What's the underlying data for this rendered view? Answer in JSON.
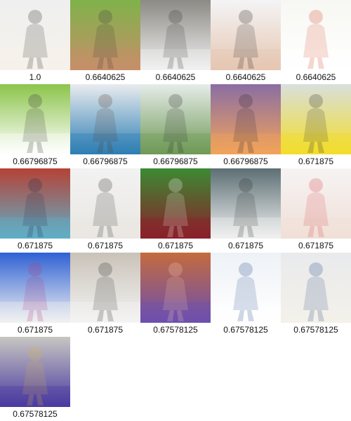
{
  "results": [
    {
      "score": "1.0",
      "thumb": "woman-white-outfit-photo",
      "colors": [
        "#efefef",
        "#f6f2ea",
        "#2b2b2b"
      ]
    },
    {
      "score": "0.6640625",
      "thumb": "man-shirtless-on-grass-photo",
      "colors": [
        "#7fb24a",
        "#c78f6a",
        "#3a3a3a"
      ]
    },
    {
      "score": "0.6640625",
      "thumb": "man-white-shirt-steps-photo",
      "colors": [
        "#8c8a84",
        "#f2f2f2",
        "#333333"
      ]
    },
    {
      "score": "0.6640625",
      "thumb": "skater-crouching-photo",
      "colors": [
        "#f4f4f6",
        "#e6c7b1",
        "#222222"
      ]
    },
    {
      "score": "0.6640625",
      "thumb": "woman-kitchen-food-photo",
      "colors": [
        "#f7f7f3",
        "#ffffff",
        "#d64b2f"
      ]
    },
    {
      "score": "0.66796875",
      "thumb": "golfer-swing-photo",
      "colors": [
        "#8cc44b",
        "#ffffff",
        "#2e2e2e"
      ]
    },
    {
      "score": "0.66796875",
      "thumb": "woman-blue-skirt-photo",
      "colors": [
        "#e9ecef",
        "#2f7fb4",
        "#5a3b2a"
      ]
    },
    {
      "score": "0.66796875",
      "thumb": "people-jumping-field-photo",
      "colors": [
        "#e6ece9",
        "#6f9a57",
        "#2b2b2b"
      ]
    },
    {
      "score": "0.66796875",
      "thumb": "fisherman-silhouette-sunset-photo",
      "colors": [
        "#8a6ea3",
        "#f2a35a",
        "#2b2230"
      ]
    },
    {
      "score": "0.671875",
      "thumb": "man-yellow-jacket-chair-photo",
      "colors": [
        "#d9dfdc",
        "#f3dd2a",
        "#2b2b2b"
      ]
    },
    {
      "score": "0.671875",
      "thumb": "people-traditional-dress-photo",
      "colors": [
        "#b54236",
        "#5fb0c8",
        "#1f2b4a"
      ]
    },
    {
      "score": "0.671875",
      "thumb": "woman-white-sweater-door-photo",
      "colors": [
        "#f2f2f2",
        "#eae7e2",
        "#2d2d2d"
      ]
    },
    {
      "score": "0.671875",
      "thumb": "man-red-tracksuit-field-photo",
      "colors": [
        "#3c8a33",
        "#8b1f2a",
        "#ffffff"
      ]
    },
    {
      "score": "0.671875",
      "thumb": "men-handshake-photo",
      "colors": [
        "#5c6f74",
        "#f1f1f1",
        "#2b2b2b"
      ]
    },
    {
      "score": "0.671875",
      "thumb": "woman-white-dress-event-photo",
      "colors": [
        "#f6f3f3",
        "#f0e0d8",
        "#d9474f"
      ]
    },
    {
      "score": "0.671875",
      "thumb": "person-striped-sweater-photo",
      "colors": [
        "#2f61d3",
        "#f2f2f2",
        "#b33a7a"
      ]
    },
    {
      "score": "0.671875",
      "thumb": "woman-striped-top-wall-photo",
      "colors": [
        "#c9c2b8",
        "#f4f4f4",
        "#2a2a2a"
      ]
    },
    {
      "score": "0.67578125",
      "thumb": "volleyball-players-net-photo",
      "colors": [
        "#c46b3d",
        "#6c4fb0",
        "#f6d0b4"
      ]
    },
    {
      "score": "0.67578125",
      "thumb": "hospital-patient-bed-photo",
      "colors": [
        "#eef2f6",
        "#ffffff",
        "#2a4f8f"
      ]
    },
    {
      "score": "0.67578125",
      "thumb": "woman-denim-shorts-photo",
      "colors": [
        "#e9eaec",
        "#f4f1ea",
        "#2d4f86"
      ]
    },
    {
      "score": "0.67578125",
      "thumb": "man-child-outdoors-photo",
      "colors": [
        "#c8c7c2",
        "#4a3aa0",
        "#d7b44b"
      ]
    }
  ]
}
